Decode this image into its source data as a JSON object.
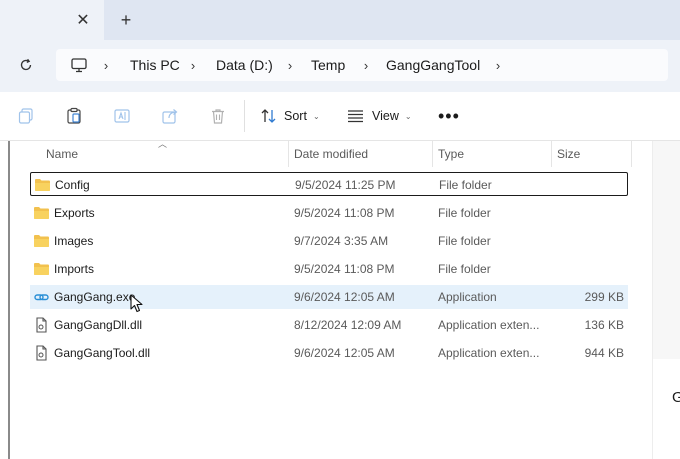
{
  "tabs": {
    "close_glyph": "✕",
    "new_tab_glyph": "+"
  },
  "breadcrumb": {
    "items": [
      "This PC",
      "Data (D:)",
      "Temp",
      "GangGangTool"
    ]
  },
  "toolbar": {
    "sort_label": "Sort",
    "view_label": "View",
    "more_label": "•••"
  },
  "columns": {
    "name": "Name",
    "date_modified": "Date modified",
    "type": "Type",
    "size": "Size"
  },
  "files": [
    {
      "name": "Config",
      "date": "9/5/2024 11:25 PM",
      "type": "File folder",
      "size": "",
      "icon": "folder-icon"
    },
    {
      "name": "Exports",
      "date": "9/5/2024 11:08 PM",
      "type": "File folder",
      "size": "",
      "icon": "folder-icon"
    },
    {
      "name": "Images",
      "date": "9/7/2024 3:35 AM",
      "type": "File folder",
      "size": "",
      "icon": "folder-icon"
    },
    {
      "name": "Imports",
      "date": "9/5/2024 11:08 PM",
      "type": "File folder",
      "size": "",
      "icon": "folder-icon"
    },
    {
      "name": "GangGang.exe",
      "date": "9/6/2024 12:05 AM",
      "type": "Application",
      "size": "299 KB",
      "icon": "application-icon"
    },
    {
      "name": "GangGangDll.dll",
      "date": "8/12/2024 12:09 AM",
      "type": "Application exten...",
      "size": "136 KB",
      "icon": "dll-file-icon"
    },
    {
      "name": "GangGangTool.dll",
      "date": "9/6/2024 12:05 AM",
      "type": "Application exten...",
      "size": "944 KB",
      "icon": "dll-file-icon"
    }
  ],
  "details_pane": {
    "partial_letter": "G"
  },
  "colors": {
    "folder": "#f2c14e",
    "hover_row": "#e5f1fb",
    "tab_strip": "#dfe6f2",
    "address_row": "#eef2f8"
  }
}
